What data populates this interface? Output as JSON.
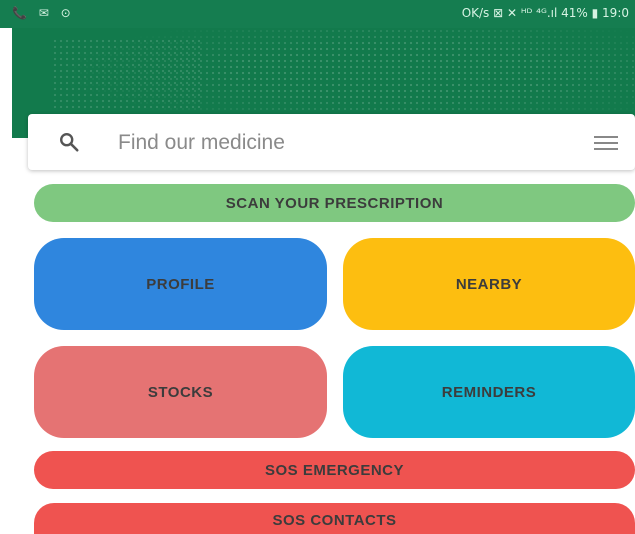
{
  "status_bar": {
    "left_icons": "📞 ✉ ⊙",
    "right_text": "OK/s ⊠ ✕ ᴴᴰ ⁴ᴳ.ıl 41% ▮ 19:0"
  },
  "search": {
    "placeholder": "Find our medicine",
    "icon": "search-icon",
    "menu_icon": "hamburger-menu-icon"
  },
  "buttons": {
    "scan": "SCAN YOUR PRESCRIPTION",
    "profile": "PROFILE",
    "nearby": "NEARBY",
    "stocks": "STOCKS",
    "reminders": "REMINDERS",
    "sos_emergency": "SOS EMERGENCY",
    "sos_contacts": "SOS CONTACTS"
  },
  "colors": {
    "header_green": "#127a4c",
    "scan": "#7fc880",
    "profile": "#2f86de",
    "nearby": "#fdbe10",
    "stocks": "#e57373",
    "reminders": "#11b8d6",
    "sos": "#ef5350"
  }
}
